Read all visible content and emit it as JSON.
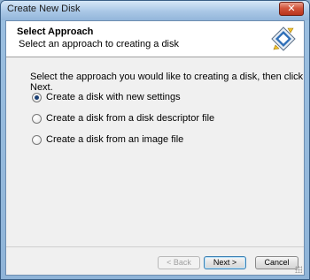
{
  "window": {
    "title": "Create New Disk",
    "close_glyph": "✕"
  },
  "header": {
    "title": "Select Approach",
    "subtitle": "Select an approach to creating a disk",
    "icon": "disk-wizard-icon"
  },
  "body": {
    "instruction": "Select the approach you would like to creating a disk, then click Next.",
    "options": [
      {
        "label": "Create a disk with new settings",
        "checked": true
      },
      {
        "label": "Create a disk from a disk descriptor file",
        "checked": false
      },
      {
        "label": "Create a disk from an image file",
        "checked": false
      }
    ]
  },
  "buttons": {
    "back": "< Back",
    "next": "Next >",
    "cancel": "Cancel"
  },
  "colors": {
    "accent": "#3c7fb1",
    "titlebar": "#9bbfe0"
  }
}
